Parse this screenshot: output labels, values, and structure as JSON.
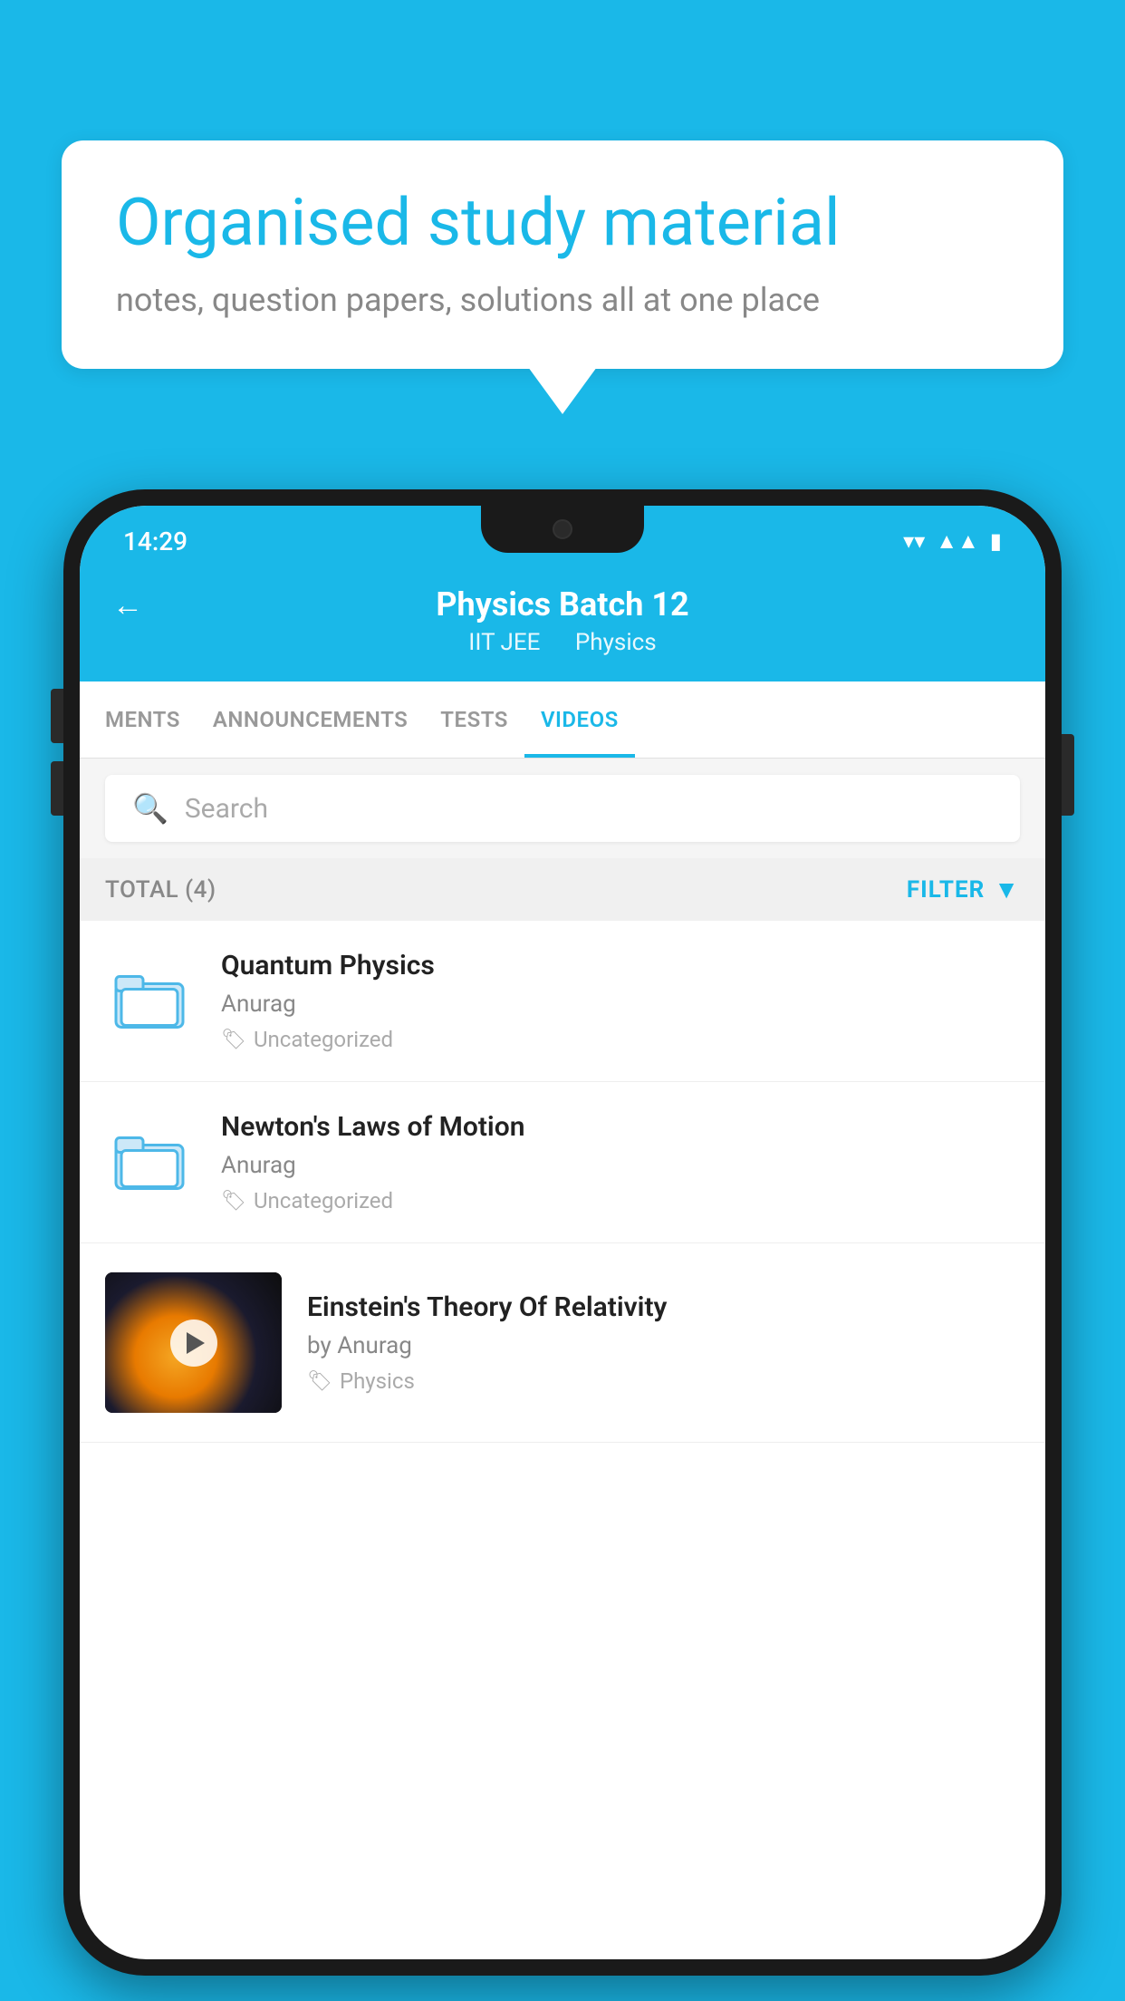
{
  "bubble": {
    "title": "Organised study material",
    "subtitle": "notes, question papers, solutions all at one place"
  },
  "status_bar": {
    "time": "14:29",
    "wifi": "▼",
    "signal": "▲",
    "battery": "▮"
  },
  "header": {
    "title": "Physics Batch 12",
    "subtitle1": "IIT JEE",
    "subtitle2": "Physics",
    "back_label": "←"
  },
  "tabs": [
    {
      "label": "MENTS",
      "active": false
    },
    {
      "label": "ANNOUNCEMENTS",
      "active": false
    },
    {
      "label": "TESTS",
      "active": false
    },
    {
      "label": "VIDEOS",
      "active": true
    }
  ],
  "search": {
    "placeholder": "Search"
  },
  "filter_bar": {
    "total_label": "TOTAL (4)",
    "filter_label": "FILTER"
  },
  "videos": [
    {
      "title": "Quantum Physics",
      "author": "Anurag",
      "tag": "Uncategorized",
      "type": "folder"
    },
    {
      "title": "Newton's Laws of Motion",
      "author": "Anurag",
      "tag": "Uncategorized",
      "type": "folder"
    },
    {
      "title": "Einstein's Theory Of Relativity",
      "author": "by Anurag",
      "tag": "Physics",
      "type": "video"
    }
  ]
}
